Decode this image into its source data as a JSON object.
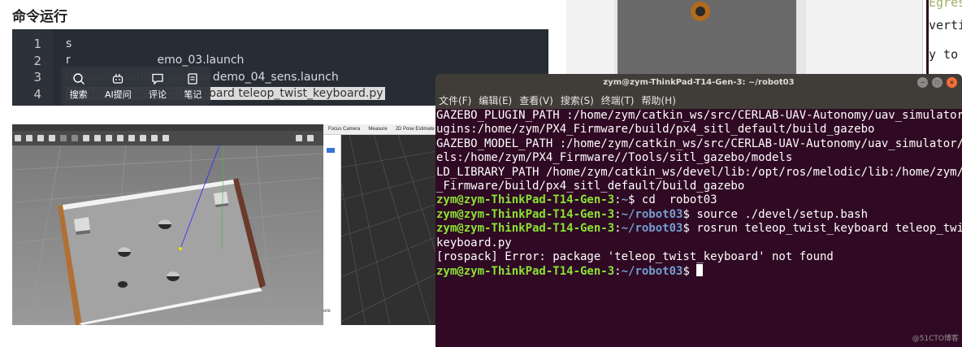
{
  "article": {
    "section_title": "命令运行",
    "code_lines": [
      {
        "num": "1",
        "text": "s"
      },
      {
        "num": "2",
        "text": "r                        emo_03.launch"
      },
      {
        "num": "3",
        "text": "roslaunch urdf02_gazebo demo_04_sens.launch"
      },
      {
        "num": "4",
        "text": "rosrun teleop_twist_keyboard teleop_twist_keyboard.py"
      }
    ],
    "toolbar": {
      "search": "搜索",
      "ai": "AI提问",
      "comment": "评论",
      "note": "笔记"
    }
  },
  "rviz": {
    "toolbar": [
      "Focus Camera",
      "Measure",
      "2D Pose Estimate"
    ],
    "side_text": "ore"
  },
  "background_terminal": {
    "lines": [
      "Egress",
      "vertis",
      "y to s"
    ]
  },
  "terminal": {
    "title": "zym@zym-ThinkPad-T14-Gen-3: ~/robot03",
    "menu": [
      "文件(F)",
      "编辑(E)",
      "查看(V)",
      "搜索(S)",
      "终端(T)",
      "帮助(H)"
    ],
    "lines": [
      {
        "type": "out",
        "text": "GAZEBO_PLUGIN_PATH :/home/zym/catkin_ws/src/CERLAB-UAV-Autonomy/uav_simulator/pl"
      },
      {
        "type": "out",
        "text": "ugins:/home/zym/PX4_Firmware/build/px4_sitl_default/build_gazebo"
      },
      {
        "type": "out",
        "text": "GAZEBO_MODEL_PATH :/home/zym/catkin_ws/src/CERLAB-UAV-Autonomy/uav_simulator/mod"
      },
      {
        "type": "out",
        "text": "els:/home/zym/PX4_Firmware//Tools/sitl_gazebo/models"
      },
      {
        "type": "out",
        "text": "LD_LIBRARY_PATH /home/zym/catkin_ws/devel/lib:/opt/ros/melodic/lib:/home/zym/PX4"
      },
      {
        "type": "out",
        "text": "_Firmware/build/px4_sitl_default/build_gazebo"
      },
      {
        "type": "prompt",
        "user": "zym@zym-ThinkPad-T14-Gen-3",
        "dir": "~",
        "cmd": " cd  robot03"
      },
      {
        "type": "prompt",
        "user": "zym@zym-ThinkPad-T14-Gen-3",
        "dir": "~/robot03",
        "cmd": " source ./devel/setup.bash"
      },
      {
        "type": "prompt",
        "user": "zym@zym-ThinkPad-T14-Gen-3",
        "dir": "~/robot03",
        "cmd": " rosrun teleop_twist_keyboard teleop_twist_"
      },
      {
        "type": "out",
        "text": "keyboard.py"
      },
      {
        "type": "out",
        "text": "[rospack] Error: package 'teleop_twist_keyboard' not found"
      },
      {
        "type": "prompt",
        "user": "zym@zym-ThinkPad-T14-Gen-3",
        "dir": "~/robot03",
        "cmd": " ",
        "cursor": true
      }
    ]
  },
  "watermark": "@51CTO博客"
}
